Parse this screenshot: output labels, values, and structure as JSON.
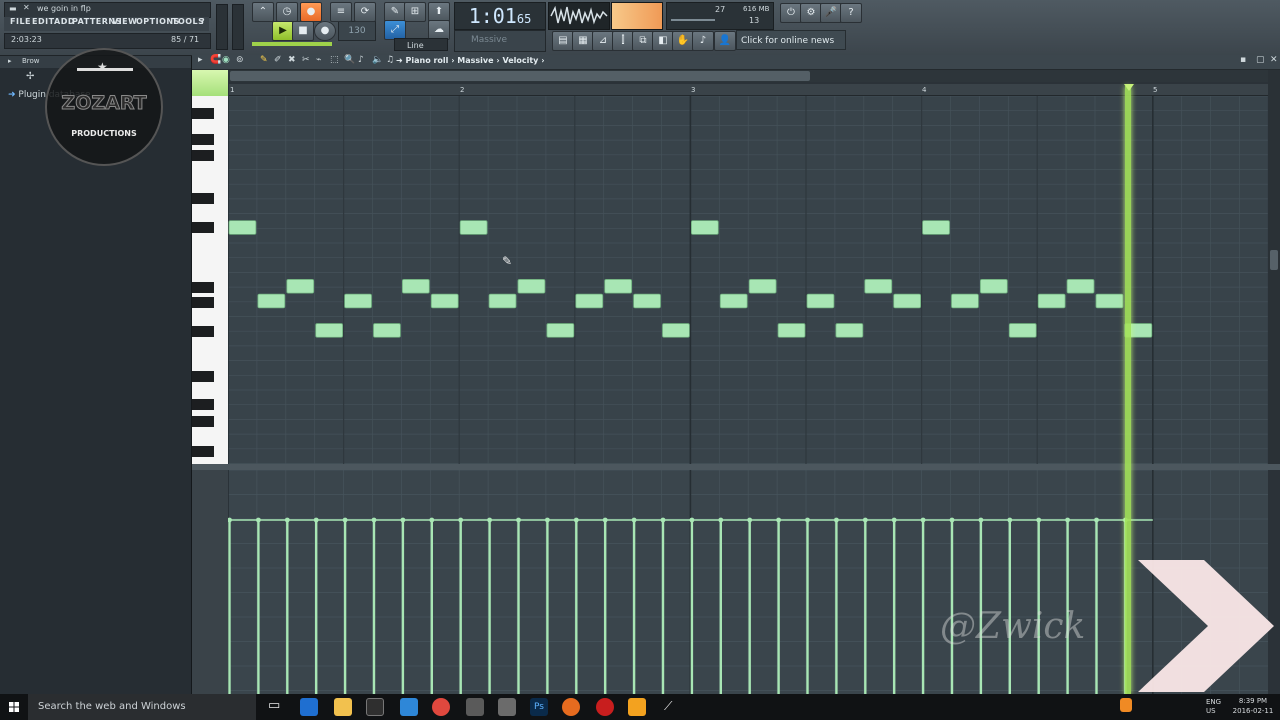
{
  "window": {
    "title": "we goin in flp",
    "menu": [
      "FILE",
      "EDIT",
      "ADD",
      "PATTERNS",
      "VIEW",
      "OPTIONS",
      "TOOLS",
      "?"
    ],
    "hint_left": "2:03:23",
    "hint_right": "85 / 71"
  },
  "transport": {
    "time": "1:01",
    "time_sub": "65",
    "snap": "Line",
    "channel_select": "Massive",
    "tempo_placeholder": "130"
  },
  "cpu": {
    "cpu": "27",
    "memory": "616 MB",
    "poly": "13"
  },
  "news": {
    "label": "Click for online news"
  },
  "browser": {
    "header": "Brow",
    "plugin_database": "Plugin database",
    "logo_text": "PRODUCTIONS",
    "logo_big": "ZOZART"
  },
  "piano_roll": {
    "breadcrumb": [
      "Piano roll",
      "Massive",
      "Velocity"
    ],
    "bar_numbers": [
      "1",
      "2",
      "3",
      "4",
      "5"
    ],
    "grid": {
      "bars": 4,
      "steps_per_bar": 16
    },
    "notes": [
      {
        "step": 0,
        "row": 0,
        "len": 1
      },
      {
        "step": 1,
        "row": 5,
        "len": 1
      },
      {
        "step": 2,
        "row": 4,
        "len": 1
      },
      {
        "step": 3,
        "row": 7,
        "len": 1
      },
      {
        "step": 4,
        "row": 5,
        "len": 1
      },
      {
        "step": 5,
        "row": 7,
        "len": 1
      },
      {
        "step": 6,
        "row": 4,
        "len": 1
      },
      {
        "step": 7,
        "row": 5,
        "len": 1
      },
      {
        "step": 8,
        "row": 0,
        "len": 1
      },
      {
        "step": 9,
        "row": 5,
        "len": 1
      },
      {
        "step": 10,
        "row": 4,
        "len": 1
      },
      {
        "step": 11,
        "row": 7,
        "len": 1
      },
      {
        "step": 12,
        "row": 5,
        "len": 1
      },
      {
        "step": 13,
        "row": 4,
        "len": 1
      },
      {
        "step": 14,
        "row": 5,
        "len": 1
      },
      {
        "step": 15,
        "row": 7,
        "len": 1
      },
      {
        "step": 16,
        "row": 0,
        "len": 1
      },
      {
        "step": 17,
        "row": 5,
        "len": 1
      },
      {
        "step": 18,
        "row": 4,
        "len": 1
      },
      {
        "step": 19,
        "row": 7,
        "len": 1
      },
      {
        "step": 20,
        "row": 5,
        "len": 1
      },
      {
        "step": 21,
        "row": 7,
        "len": 1
      },
      {
        "step": 22,
        "row": 4,
        "len": 1
      },
      {
        "step": 23,
        "row": 5,
        "len": 1
      },
      {
        "step": 24,
        "row": 0,
        "len": 1
      },
      {
        "step": 25,
        "row": 5,
        "len": 1
      },
      {
        "step": 26,
        "row": 4,
        "len": 1
      },
      {
        "step": 27,
        "row": 7,
        "len": 1
      },
      {
        "step": 28,
        "row": 5,
        "len": 1
      },
      {
        "step": 29,
        "row": 4,
        "len": 1
      },
      {
        "step": 30,
        "row": 5,
        "len": 1
      },
      {
        "step": 31,
        "row": 7,
        "len": 1
      }
    ],
    "playhead_step": 31,
    "velocity_count": 32
  },
  "watermark": "@Zwick",
  "taskbar": {
    "search_placeholder": "Search the web and Windows",
    "time": "8:39 PM",
    "date": "2016-02-11",
    "lang": "ENG",
    "region": "US"
  },
  "colors": {
    "note_fill": "#a8e6b4",
    "note_stroke": "#6fb07e",
    "grid_bg": "#38434a",
    "grid_line": "#45525a",
    "bar_line": "#262e33",
    "playhead": "#a4e35a"
  }
}
